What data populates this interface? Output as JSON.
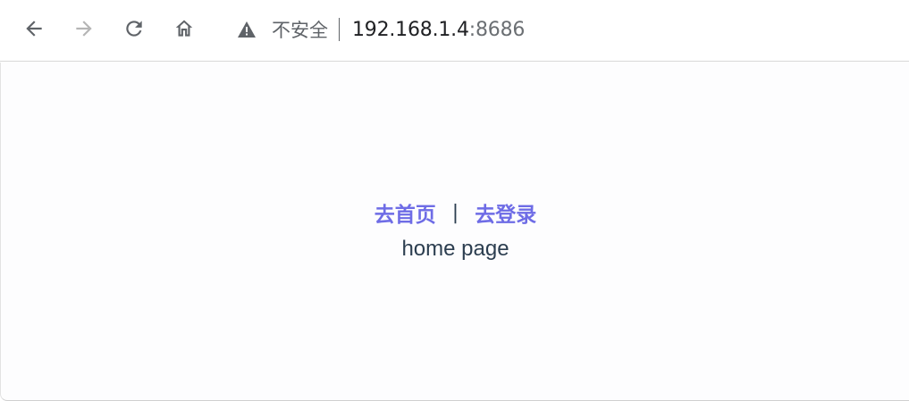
{
  "toolbar": {
    "back_icon": "arrow-left-icon",
    "forward_icon": "arrow-right-icon",
    "reload_icon": "reload-icon",
    "home_icon": "home-icon",
    "security_icon": "warning-triangle-icon",
    "security_label": "不安全",
    "url_host": "192.168.1.4",
    "url_port": ":8686"
  },
  "page": {
    "nav": {
      "home_link": "去首页",
      "separator": "|",
      "login_link": "去登录"
    },
    "content_text": "home page"
  },
  "colors": {
    "link": "#6e6ce6",
    "text": "#2c3e50",
    "icon_active": "#5f6368",
    "icon_disabled": "#b5b5b5"
  }
}
